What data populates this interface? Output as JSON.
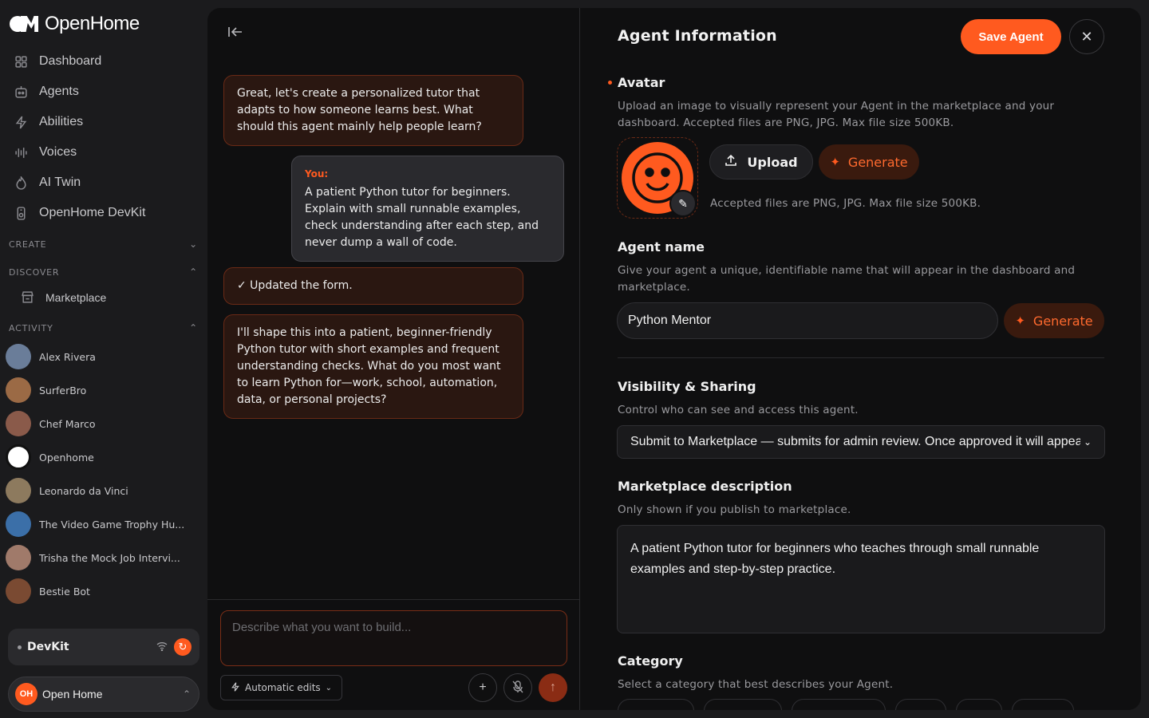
{
  "brand": {
    "name": "OpenHome"
  },
  "nav": [
    {
      "label": "Dashboard",
      "icon": "grid-icon"
    },
    {
      "label": "Agents",
      "icon": "robot-icon"
    },
    {
      "label": "Abilities",
      "icon": "lightning-icon"
    },
    {
      "label": "Voices",
      "icon": "waveform-icon"
    },
    {
      "label": "AI Twin",
      "icon": "flame-icon"
    },
    {
      "label": "OpenHome DevKit",
      "icon": "device-icon"
    }
  ],
  "sections": {
    "create": "CREATE",
    "discover": "DISCOVER",
    "activity": "ACTIVITY"
  },
  "discover_items": [
    {
      "label": "Marketplace",
      "icon": "store-icon"
    }
  ],
  "activity": [
    {
      "name": "Alex Rivera",
      "color": "#6a7d99"
    },
    {
      "name": "SurferBro",
      "color": "#9b6a45"
    },
    {
      "name": "Chef Marco",
      "color": "#8a5a4a"
    },
    {
      "name": "Openhome",
      "color": "#ffffff"
    },
    {
      "name": "Leonardo da Vinci",
      "color": "#8d7a5e"
    },
    {
      "name": "The Video Game Trophy Hu...",
      "color": "#3b6fa8"
    },
    {
      "name": "Trisha the Mock Job Intervi...",
      "color": "#a07a6a"
    },
    {
      "name": "Bestie Bot",
      "color": "#7a4a32"
    }
  ],
  "devkit": {
    "label": "DevKit"
  },
  "account": {
    "initials": "OH",
    "name": "Open Home"
  },
  "chat": {
    "messages": [
      {
        "role": "bot",
        "text": "Great, let's create a personalized tutor that adapts to how someone learns best. What should this agent mainly help people learn?"
      },
      {
        "role": "user",
        "speaker": "You:",
        "text": "A patient Python tutor for beginners. Explain with small runnable examples, check understanding after each step, and never dump a wall of code."
      },
      {
        "role": "bot",
        "text": "✓ Updated the form."
      },
      {
        "role": "bot",
        "text": "I'll shape this into a patient, beginner-friendly Python tutor with short examples and frequent understanding checks. What do you most want to learn Python for—work, school, automation, data, or personal projects?"
      }
    ],
    "input_placeholder": "Describe what you want to build...",
    "auto_edits_label": "Automatic edits"
  },
  "form": {
    "title": "Agent Information",
    "save_label": "Save Agent",
    "avatar": {
      "label": "Avatar",
      "help": "Upload an image to visually represent your Agent in the marketplace and your dashboard. Accepted files are PNG, JPG. Max file size 500KB.",
      "upload_label": "Upload",
      "generate_label": "Generate",
      "note": "Accepted files are PNG, JPG. Max file size 500KB."
    },
    "agent_name": {
      "label": "Agent name",
      "help": "Give your agent a unique, identifiable name that will appear in the dashboard and marketplace.",
      "value": "Python Mentor",
      "generate_label": "Generate"
    },
    "visibility": {
      "label": "Visibility & Sharing",
      "help": "Control who can see and access this agent.",
      "selected": "Submit to Marketplace — submits for admin review. Once approved it will appear"
    },
    "description": {
      "label": "Marketplace description",
      "help": "Only shown if you publish to marketplace.",
      "value": "A patient Python tutor for beginners who teaches through small runnable examples and step-by-step practice."
    },
    "category": {
      "label": "Category",
      "help": "Select a category that best describes your Agent."
    }
  },
  "colors": {
    "accent": "#ff5a1f",
    "panel": "#0f0f10",
    "sidebar": "#1b1b1d"
  }
}
